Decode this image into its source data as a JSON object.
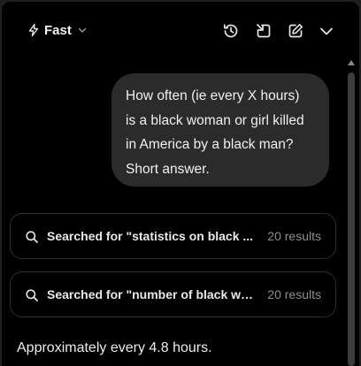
{
  "header": {
    "model_label": "Fast",
    "icons": [
      "bolt-icon",
      "chevron-down-icon",
      "history-icon",
      "new-window-icon",
      "edit-icon",
      "collapse-chevron-icon"
    ]
  },
  "conversation": {
    "user_message_lines": [
      "How often (ie every X hours)",
      "is a black woman or girl killed",
      "in America by a black man?",
      "Short answer."
    ],
    "searches": [
      {
        "text": "Searched for \"statistics on black ...",
        "count": "20 results"
      },
      {
        "text": "Searched for \"number of black wo...",
        "count": "20 results"
      }
    ],
    "answer": "Approximately every 4.8 hours."
  },
  "colors": {
    "background": "#000000",
    "bubble": "#2b2b2b",
    "card_border": "#2f2f2f",
    "muted_text": "#8e8e8e"
  }
}
